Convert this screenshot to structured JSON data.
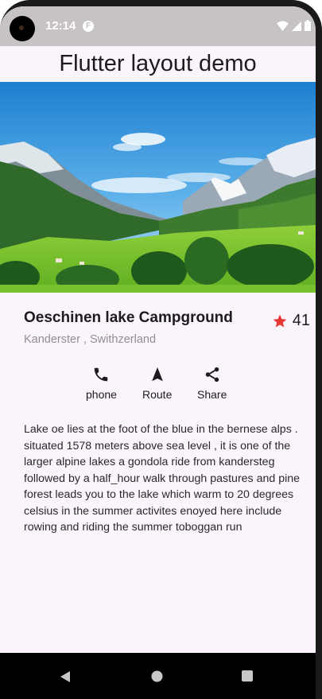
{
  "status_bar": {
    "time": "12:14",
    "f_glyph": "F",
    "icons": [
      "wifi-icon",
      "signal-icon",
      "battery-icon"
    ]
  },
  "app_bar": {
    "title": "Flutter layout demo"
  },
  "hero": {
    "image": "alpine-lake-landscape"
  },
  "place": {
    "name": "Oeschinen lake Campground",
    "location": "Kanderster , Swithzerland",
    "rating_count": "41",
    "star_color": "#e53935"
  },
  "actions": [
    {
      "icon": "phone-icon",
      "label": "phone"
    },
    {
      "icon": "route-icon",
      "label": "Route"
    },
    {
      "icon": "share-icon",
      "label": "Share"
    }
  ],
  "description": "Lake oe lies at the foot of the blue in the bernese alps . situated 1578 meters above sea level , it is one of the larger alpine lakes a gondola ride from kandersteg followed by a half_hour walk through pastures and pine forest leads you to the lake which warm to 20 degrees celsius in the summer activites enoyed here include rowing and riding the summer toboggan run",
  "nav": [
    "back-icon",
    "home-icon",
    "recents-icon"
  ]
}
